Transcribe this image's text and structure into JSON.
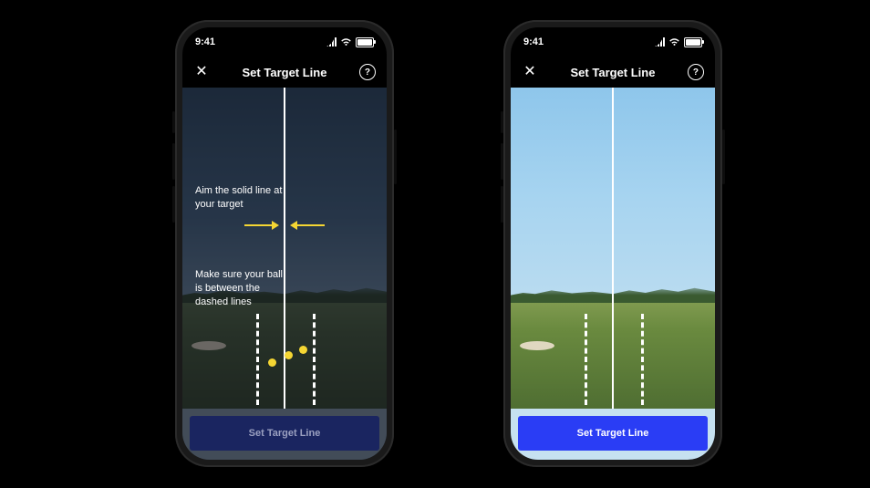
{
  "status": {
    "time": "9:41"
  },
  "nav": {
    "title": "Set Target Line",
    "help_glyph": "?"
  },
  "instructions": {
    "aim": "Aim the solid line at your target",
    "ball": "Make sure your ball is between the dashed lines"
  },
  "cta": {
    "label": "Set Target Line"
  },
  "colors": {
    "accent_arrow": "#f5d633",
    "cta_active": "#2a3df5",
    "cta_disabled": "#1a2560"
  }
}
